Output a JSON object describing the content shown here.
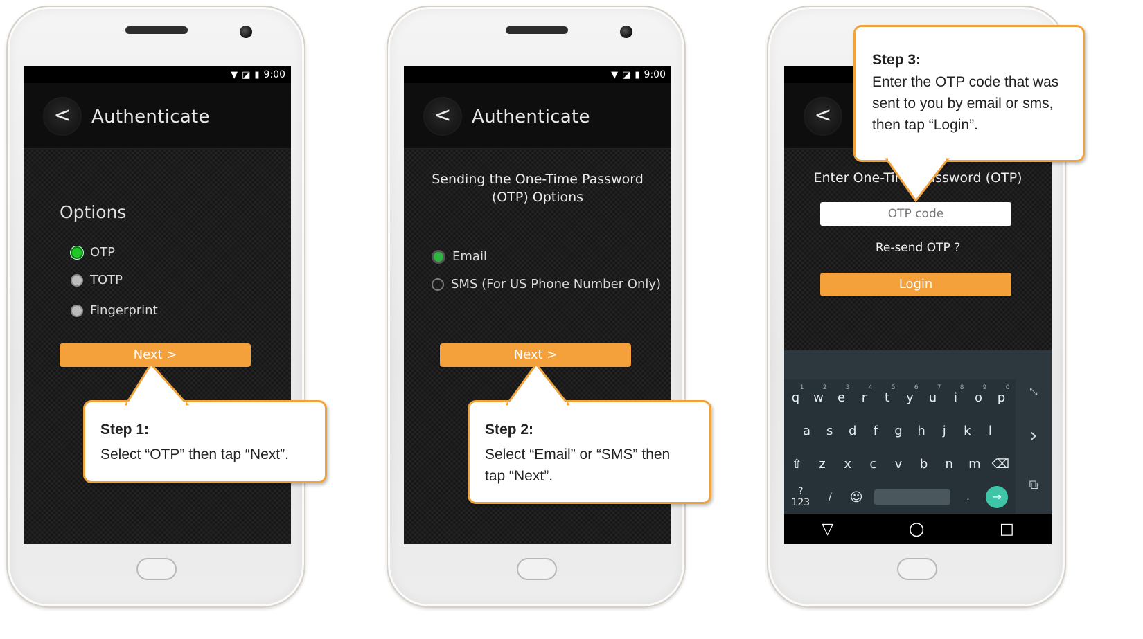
{
  "status": {
    "time": "9:00",
    "wifi_icon": "wifi-icon",
    "nosim_icon": "no-sim-icon",
    "battery_icon": "battery-icon"
  },
  "phone1": {
    "back_glyph": "<",
    "title": "Authenticate",
    "options_title": "Options",
    "options": [
      {
        "label": "OTP",
        "selected": true
      },
      {
        "label": "TOTP",
        "selected": false
      },
      {
        "label": "Fingerprint",
        "selected": false
      }
    ],
    "next_label": "Next >",
    "callout": {
      "step": "Step 1:",
      "text": "Select “OTP” then tap “Next”."
    }
  },
  "phone2": {
    "back_glyph": "<",
    "title": "Authenticate",
    "heading_line1": "Sending the One-Time Password",
    "heading_line2": "(OTP) Options",
    "options": [
      {
        "label": "Email",
        "selected": true
      },
      {
        "label": "SMS (For US Phone Number Only)",
        "selected": false
      }
    ],
    "next_label": "Next >",
    "callout": {
      "step": "Step 2:",
      "text": "Select “Email” or “SMS” then tap “Next”."
    }
  },
  "phone3": {
    "back_glyph": "<",
    "heading": "Enter One-Time Password (OTP)",
    "otp_placeholder": "OTP code",
    "resend": "Re-send OTP ?",
    "login_label": "Login",
    "callout": {
      "step": "Step 3:",
      "text": "Enter the OTP code that was sent to you by email or sms, then tap “Login”."
    },
    "keyboard": {
      "row1": [
        "q",
        "w",
        "e",
        "r",
        "t",
        "y",
        "u",
        "i",
        "o",
        "p"
      ],
      "row1_digits": [
        "1",
        "2",
        "3",
        "4",
        "5",
        "6",
        "7",
        "8",
        "9",
        "0"
      ],
      "row2": [
        "a",
        "s",
        "d",
        "f",
        "g",
        "h",
        "j",
        "k",
        "l"
      ],
      "row3": [
        "z",
        "x",
        "c",
        "v",
        "b",
        "n",
        "m"
      ],
      "shift_glyph": "⇧",
      "backspace_glyph": "⌫",
      "symbols_key": "?123",
      "slash_key": "/",
      "emoji_glyph": "☺",
      "period_key": ".",
      "enter_glyph": "→",
      "side_collapse_glyph": "⤡",
      "side_arrow_glyph": "›",
      "side_popout_glyph": "⧉"
    },
    "nav": {
      "back": "▽",
      "home": "○",
      "recent": "□"
    }
  },
  "colors": {
    "accent": "#f5a13b",
    "radio_on": "#21c628",
    "keyboard_bg": "#263238",
    "enter_key": "#3ec4a6"
  }
}
